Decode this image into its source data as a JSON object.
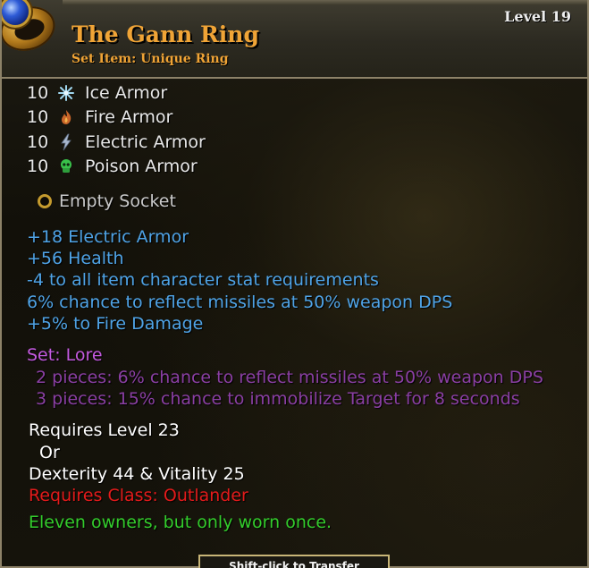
{
  "item": {
    "name": "The Gann Ring",
    "subtitle": "Set Item: Unique Ring",
    "level": "Level 19",
    "icon": "ring-with-blue-gem"
  },
  "armor": [
    {
      "value": "10",
      "label": "Ice Armor",
      "icon": "snowflake-icon",
      "color": "#9fd6ee"
    },
    {
      "value": "10",
      "label": "Fire Armor",
      "icon": "flame-icon",
      "color": "#d9772a"
    },
    {
      "value": "10",
      "label": "Electric Armor",
      "icon": "lightning-icon",
      "color": "#a9b8cf"
    },
    {
      "value": "10",
      "label": "Poison Armor",
      "icon": "poison-skull-icon",
      "color": "#39c14a"
    }
  ],
  "socket": {
    "label": "Empty Socket"
  },
  "bonuses": [
    "+18 Electric Armor",
    "+56 Health",
    "-4 to all item character stat requirements",
    "6% chance to reflect missiles at 50% weapon DPS",
    "+5% to Fire Damage"
  ],
  "set": {
    "label": "Set: Lore",
    "pieces": [
      "2 pieces: 6% chance to reflect missiles at 50% weapon DPS",
      "3 pieces: 15% chance to immobilize Target for 8 seconds"
    ]
  },
  "requirements": {
    "level": "Requires Level 23",
    "or": "Or",
    "stats": "Dexterity 44 & Vitality 25",
    "class": "Requires Class: Outlander"
  },
  "flavor": "Eleven owners, but only worn once.",
  "footer": {
    "label": "Shift-click to Transfer"
  },
  "colors": {
    "title": "#f0a436",
    "magic_bonus": "#4fa3e6",
    "set_name": "#c35adf",
    "set_bonus": "#8a3fa3",
    "class_requirement": "#e31b1b",
    "flavor": "#33cc2c"
  }
}
